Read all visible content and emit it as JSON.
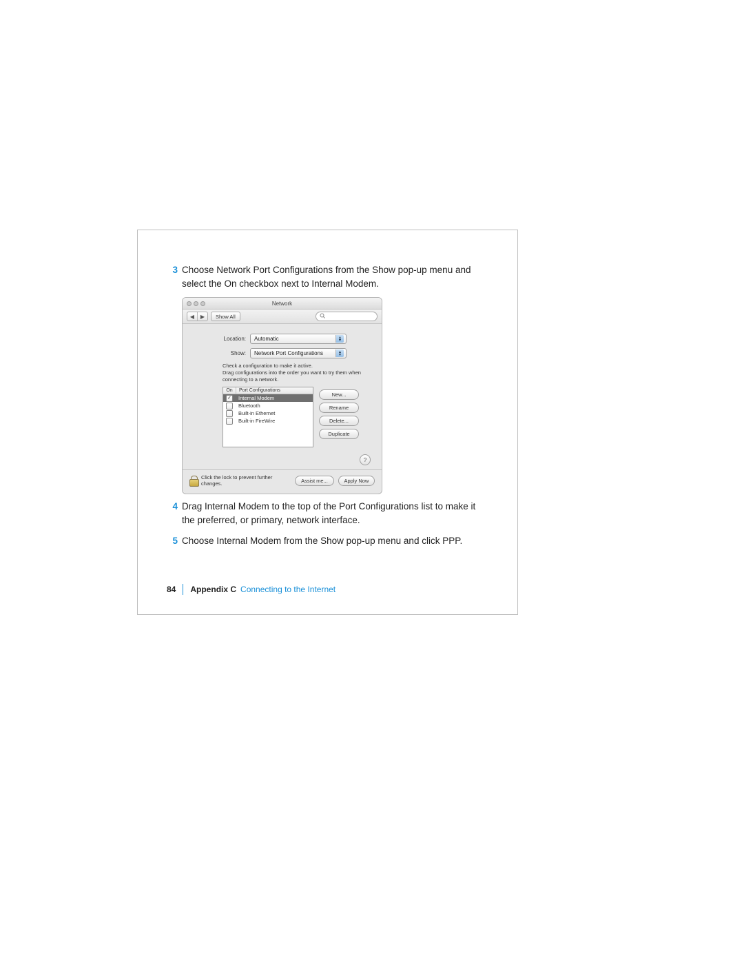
{
  "steps": {
    "s3": {
      "num": "3",
      "text": "Choose Network Port Configurations from the Show pop-up menu and select the On checkbox next to Internal Modem."
    },
    "s4": {
      "num": "4",
      "text": "Drag Internal Modem to the top of the Port Configurations list to make it the preferred, or primary, network interface."
    },
    "s5": {
      "num": "5",
      "text": "Choose Internal Modem from the Show pop-up menu and click PPP."
    }
  },
  "window": {
    "title": "Network",
    "toolbar": {
      "back_glyph": "◀",
      "fwd_glyph": "▶",
      "show_all": "Show All",
      "search_icon_name": "search-icon"
    },
    "location_label": "Location:",
    "location_value": "Automatic",
    "show_label": "Show:",
    "show_value": "Network Port Configurations",
    "hint_line1": "Check a configuration to make it active.",
    "hint_line2": "Drag configurations into the order you want to try them when connecting to a network.",
    "columns": {
      "on": "On",
      "port": "Port Configurations"
    },
    "rows": [
      {
        "checked": true,
        "label": "Internal Modem",
        "selected": true
      },
      {
        "checked": false,
        "label": "Bluetooth",
        "selected": false
      },
      {
        "checked": false,
        "label": "Built-in Ethernet",
        "selected": false
      },
      {
        "checked": false,
        "label": "Built-in FireWire",
        "selected": false
      }
    ],
    "buttons": {
      "new": "New...",
      "rename": "Rename",
      "delete": "Delete...",
      "duplicate": "Duplicate"
    },
    "help_glyph": "?",
    "lock_text": "Click the lock to prevent further changes.",
    "assist": "Assist me...",
    "apply": "Apply Now"
  },
  "footer": {
    "page_number": "84",
    "appendix": "Appendix C",
    "link": "Connecting to the Internet"
  }
}
